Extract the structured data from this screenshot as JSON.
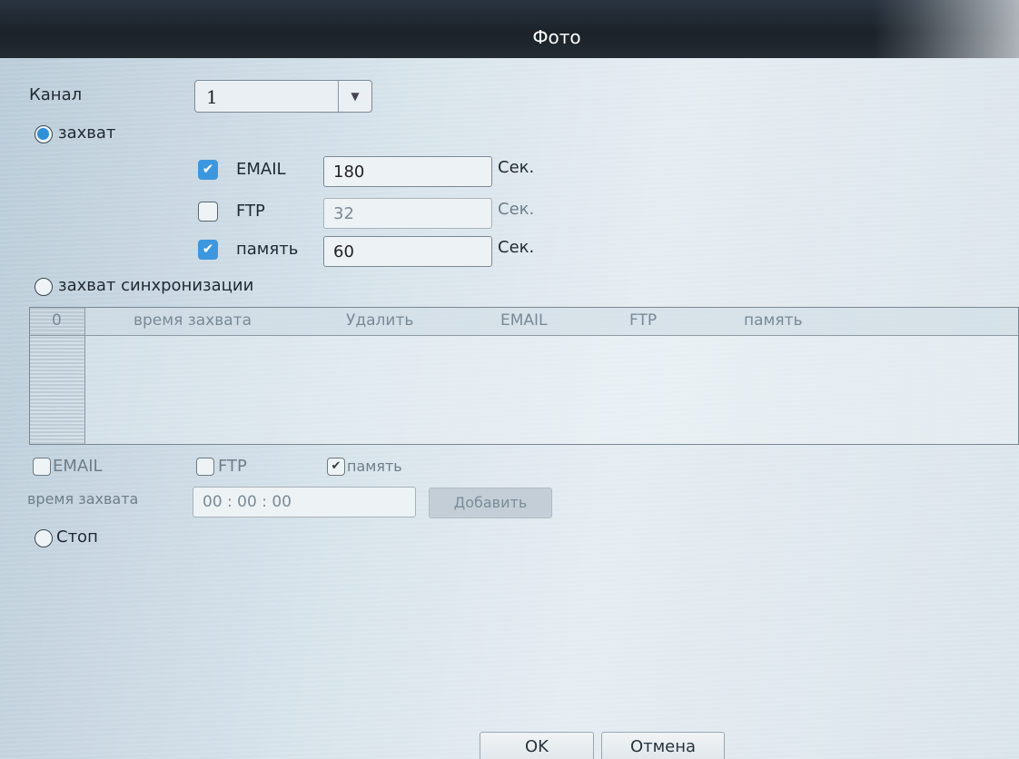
{
  "window": {
    "title": "Фото"
  },
  "channel": {
    "label": "Канал",
    "value": "1"
  },
  "capture_mode": {
    "label": "захват",
    "selected": true,
    "rows": [
      {
        "label": "EMAIL",
        "checked": true,
        "value": "180",
        "unit": "Сек.",
        "enabled": true
      },
      {
        "label": "FTP",
        "checked": false,
        "value": "32",
        "unit": "Сек.",
        "enabled": false
      },
      {
        "label": "память",
        "checked": true,
        "value": "60",
        "unit": "Сек.",
        "enabled": true
      }
    ]
  },
  "sync_mode": {
    "label": "захват синхронизации",
    "selected": false,
    "table": {
      "index_header": "0",
      "columns": [
        "время захвата",
        "Удалить",
        "EMAIL",
        "FTP",
        "память"
      ]
    },
    "options": [
      {
        "label": "EMAIL",
        "checked": false
      },
      {
        "label": "FTP",
        "checked": false
      },
      {
        "label": "память",
        "checked": true
      }
    ],
    "time_label": "время захвата",
    "time_value": "00 : 00 : 00",
    "add_button": "Добавить"
  },
  "stop_mode": {
    "label": "Стоп",
    "selected": false
  },
  "footer": {
    "ok": "OK",
    "cancel": "Отмена"
  },
  "colors": {
    "accent": "#3d97de",
    "titlebar": "#1b2229",
    "panel": "#d6e2ea"
  },
  "icons": {
    "dropdown": "chevron-down-icon",
    "checked": "checkmark-icon"
  }
}
